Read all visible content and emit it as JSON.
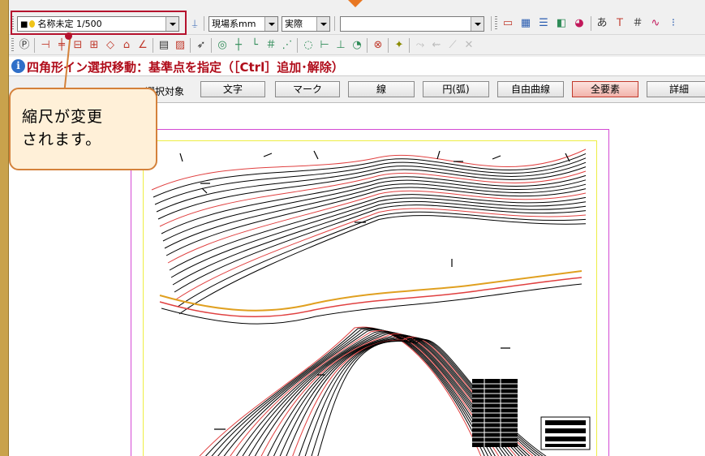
{
  "toolbar": {
    "scale_combo": {
      "icon_glyph": "■",
      "value": "名称未定 1/500"
    },
    "unit_combo": {
      "value": "現場系mm"
    },
    "mode_combo": {
      "value": "実際"
    },
    "layer_combo": {
      "value": ""
    },
    "row1_icons": [
      {
        "name": "window-icon",
        "glyph": "▭",
        "color": "#c0392b"
      },
      {
        "name": "grid-panel-icon",
        "glyph": "▦",
        "color": "#2a5db0"
      },
      {
        "name": "layer-list-icon",
        "glyph": "☰",
        "color": "#2a5db0"
      },
      {
        "name": "layer-stack-icon",
        "glyph": "◧",
        "color": "#2e8b57"
      },
      {
        "name": "color-palette-icon",
        "glyph": "◕",
        "color": "#c2185b"
      },
      {
        "name": "text-style-icon",
        "glyph": "あ",
        "color": "#333333"
      },
      {
        "name": "text-size-icon",
        "glyph": "Ｔ",
        "color": "#c0392b"
      },
      {
        "name": "hatch-grid-icon",
        "glyph": "＃",
        "color": "#333333"
      },
      {
        "name": "curve-icon",
        "glyph": "∿",
        "color": "#c2185b"
      },
      {
        "name": "point-icon",
        "glyph": "⁝",
        "color": "#2a5db0"
      }
    ],
    "row2_icons": [
      {
        "name": "parking-symbol-icon",
        "glyph": "Ⓟ",
        "color": "#333333"
      },
      {
        "name": "horizontal-line-icon",
        "glyph": "⊣",
        "color": "#c0392b"
      },
      {
        "name": "slant-line-icon",
        "glyph": "╪",
        "color": "#c0392b"
      },
      {
        "name": "rect-minus-icon",
        "glyph": "⊟",
        "color": "#c0392b"
      },
      {
        "name": "rect-split-icon",
        "glyph": "⊞",
        "color": "#c0392b"
      },
      {
        "name": "diamond-icon",
        "glyph": "◇",
        "color": "#c0392b"
      },
      {
        "name": "house-icon",
        "glyph": "⌂",
        "color": "#c0392b"
      },
      {
        "name": "angle-icon",
        "glyph": "∠",
        "color": "#c0392b"
      },
      {
        "name": "text-frame-icon",
        "glyph": "▤",
        "color": "#333333"
      },
      {
        "name": "image-frame-icon",
        "glyph": "▨",
        "color": "#c0392b"
      },
      {
        "name": "select-arrow-icon",
        "glyph": "➶",
        "color": "#333333"
      },
      {
        "name": "snap-circle-icon",
        "glyph": "◎",
        "color": "#2e8b57"
      },
      {
        "name": "snap-cross-icon",
        "glyph": "┼",
        "color": "#2e8b57"
      },
      {
        "name": "snap-corner-icon",
        "glyph": "└",
        "color": "#2e8b57"
      },
      {
        "name": "snap-grid-icon",
        "glyph": "＃",
        "color": "#2e8b57"
      },
      {
        "name": "snap-point-icon",
        "glyph": "⋰",
        "color": "#2e8b57"
      },
      {
        "name": "snap-center-icon",
        "glyph": "◌",
        "color": "#2e8b57"
      },
      {
        "name": "snap-end-icon",
        "glyph": "⊢",
        "color": "#2e8b57"
      },
      {
        "name": "snap-mid-icon",
        "glyph": "⊥",
        "color": "#2e8b57"
      },
      {
        "name": "snap-tangent-icon",
        "glyph": "◔",
        "color": "#2e8b57"
      },
      {
        "name": "snap-cancel-icon",
        "glyph": "⊗",
        "color": "#c0392b"
      },
      {
        "name": "snap-figure-icon",
        "glyph": "✦",
        "color": "#8a8a00"
      },
      {
        "name": "disabled-1-icon",
        "glyph": "⤳",
        "color": "#bbbbbb"
      },
      {
        "name": "disabled-2-icon",
        "glyph": "⇜",
        "color": "#bbbbbb"
      },
      {
        "name": "disabled-3-icon",
        "glyph": "⟋",
        "color": "#bbbbbb"
      },
      {
        "name": "disabled-4-icon",
        "glyph": "✕",
        "color": "#bbbbbb"
      }
    ]
  },
  "instruction": {
    "text": "四角形イン選択移動：基準点を指定（［Ctrl］追加･解除）"
  },
  "selection": {
    "label": "選択対象",
    "filters": [
      {
        "label": "文字",
        "active": false
      },
      {
        "label": "マーク",
        "active": false
      },
      {
        "label": "線",
        "active": false
      },
      {
        "label": "円(弧)",
        "active": false
      },
      {
        "label": "自由曲線",
        "active": false
      },
      {
        "label": "全要素",
        "active": true
      },
      {
        "label": "詳細",
        "active": false
      }
    ]
  },
  "callout": {
    "text": "縮尺が変更\nされます。"
  },
  "colors": {
    "highlight": "#b5122e",
    "callout_border": "#d4813a",
    "callout_fill": "#fff0d8",
    "instruction_text": "#b00c1a",
    "sheet_border": "#d44ad4",
    "drawing_frame": "#eeee44"
  }
}
